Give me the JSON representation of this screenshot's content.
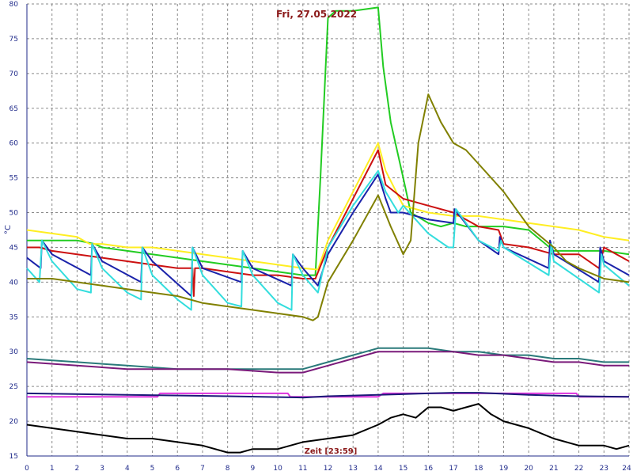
{
  "chart_data": {
    "type": "line",
    "title": "Fri, 27.05.2022",
    "xlabel": "",
    "ylabel": "°C",
    "annotation": "Zeit [23:59]",
    "xlim": [
      0,
      24
    ],
    "ylim": [
      15,
      80
    ],
    "xticks": [
      0,
      1,
      2,
      3,
      4,
      5,
      6,
      7,
      8,
      9,
      10,
      11,
      12,
      13,
      14,
      15,
      16,
      17,
      18,
      19,
      20,
      21,
      22,
      23,
      24
    ],
    "yticks": [
      15,
      20,
      25,
      30,
      35,
      40,
      45,
      50,
      55,
      60,
      65,
      70,
      75,
      80
    ],
    "grid": true,
    "series": [
      {
        "color": "#22cc22",
        "x": [
          0,
          1,
          2,
          2.7,
          3,
          4,
          5,
          6,
          7,
          8,
          9,
          10,
          11,
          11.5,
          11.7,
          12,
          12.3,
          13,
          14,
          14.2,
          14.5,
          15,
          15.3,
          16,
          16.5,
          17,
          17.5,
          18,
          19,
          20,
          21,
          21.5,
          22,
          23,
          24
        ],
        "y": [
          46,
          46,
          46,
          45.5,
          45,
          44.5,
          44,
          43.5,
          43,
          42.5,
          42,
          41.5,
          41,
          41,
          55,
          78,
          79,
          79,
          79.5,
          71,
          63,
          55,
          50,
          48.5,
          48,
          48.5,
          48,
          48,
          48,
          47.5,
          44.5,
          44.5,
          44.5,
          44.5,
          44
        ]
      },
      {
        "color": "#ffee22",
        "x": [
          0,
          1,
          2,
          2.5,
          3,
          4,
          5,
          6,
          7,
          8,
          9,
          10,
          11,
          11.6,
          12,
          13,
          14,
          14.3,
          15,
          16,
          17,
          18,
          19,
          20,
          21,
          22,
          23,
          24
        ],
        "y": [
          47.5,
          47,
          46.5,
          45.5,
          45.5,
          45,
          45,
          44.5,
          44,
          43.5,
          43,
          42.5,
          42,
          41.8,
          46,
          53,
          60,
          56,
          51,
          50,
          49.5,
          49.5,
          49,
          48.5,
          48,
          47.5,
          46.5,
          46
        ]
      },
      {
        "color": "#cc1111",
        "x": [
          0,
          0.5,
          1,
          2,
          3,
          4,
          5,
          6,
          6.6,
          6.65,
          6.7,
          7,
          8,
          9,
          10,
          11,
          11.5,
          12,
          13,
          14,
          14.3,
          15,
          16,
          17,
          18,
          18.8,
          19,
          20,
          21,
          21.5,
          22,
          22.8,
          23,
          24
        ],
        "y": [
          45,
          45,
          44.5,
          44,
          43.5,
          43,
          42.5,
          42,
          42,
          38,
          42,
          42,
          41.5,
          41,
          41,
          40.5,
          40.5,
          45,
          52,
          59,
          54,
          52,
          51,
          50,
          48,
          47.5,
          45.5,
          45,
          44,
          44,
          44,
          42,
          45,
          43
        ]
      },
      {
        "color": "#1a22aa",
        "x": [
          0,
          0.55,
          0.6,
          1,
          2.55,
          2.6,
          3,
          4.55,
          4.6,
          5,
          6.55,
          6.6,
          7,
          8.55,
          8.6,
          9,
          10.55,
          10.6,
          11,
          11.6,
          12,
          13,
          14,
          14.3,
          14.5,
          15,
          16,
          17,
          17.05,
          18,
          18.8,
          18.85,
          19,
          20.8,
          20.85,
          21,
          22.8,
          22.85,
          23,
          24
        ],
        "y": [
          43.5,
          42,
          46,
          44,
          41,
          45.5,
          43,
          40,
          45,
          43,
          38,
          45,
          42,
          40,
          44.5,
          42,
          39.5,
          44,
          42,
          39.5,
          44,
          50,
          55.5,
          52,
          50,
          50,
          49,
          48.5,
          50.5,
          46,
          44,
          46.5,
          45,
          42,
          46,
          44,
          40,
          45,
          43,
          41
        ]
      },
      {
        "color": "#33dddd",
        "x": [
          0,
          0.5,
          0.6,
          1,
          2,
          2.55,
          2.6,
          3,
          4,
          4.55,
          4.6,
          5,
          6,
          6.55,
          6.6,
          7,
          8,
          8.55,
          8.6,
          9,
          10,
          10.55,
          10.6,
          11,
          11.6,
          12,
          13,
          14,
          14.3,
          14.8,
          15,
          16,
          16.8,
          17,
          17.1,
          18,
          18.8,
          18.9,
          19,
          20.8,
          20.9,
          21,
          22.8,
          22.9,
          23,
          24
        ],
        "y": [
          42,
          40,
          46,
          43,
          39,
          38.5,
          45.5,
          42,
          38.5,
          37.5,
          45,
          41,
          37.5,
          36,
          45,
          41,
          37,
          36.5,
          44.5,
          41,
          37,
          36,
          44,
          41,
          38.5,
          45,
          51,
          56,
          53,
          50,
          51,
          47,
          45,
          45,
          50.5,
          46,
          44.5,
          46,
          45,
          41,
          45.5,
          43,
          38.5,
          44,
          42.5,
          39.5
        ]
      },
      {
        "color": "#808000",
        "x": [
          0,
          1,
          2,
          3,
          4,
          5,
          6,
          7,
          8,
          9,
          10,
          11,
          11.4,
          11.6,
          12,
          13,
          14,
          14.5,
          15,
          15.3,
          15.6,
          16,
          16.5,
          17,
          17.5,
          18,
          19,
          20,
          21,
          21.5,
          22,
          23,
          24
        ],
        "y": [
          40.5,
          40.5,
          40,
          39.5,
          39,
          38.5,
          38,
          37,
          36.5,
          36,
          35.5,
          35,
          34.5,
          35,
          40,
          46,
          52.5,
          48,
          44,
          46,
          60,
          67,
          63,
          60,
          59,
          57,
          53,
          48,
          45,
          43,
          42,
          40.5,
          40
        ]
      },
      {
        "color": "#2a7a7a",
        "x": [
          0,
          2,
          4,
          6,
          8,
          10,
          11,
          12,
          13,
          14,
          15,
          16,
          17,
          18,
          19,
          20,
          21,
          22,
          23,
          24
        ],
        "y": [
          29,
          28.5,
          28,
          27.5,
          27.5,
          27.5,
          27.5,
          28.5,
          29.5,
          30.5,
          30.5,
          30.5,
          30,
          30,
          29.5,
          29.5,
          29,
          29,
          28.5,
          28.5
        ]
      },
      {
        "color": "#7a1a7a",
        "x": [
          0,
          2,
          4,
          6,
          8,
          10,
          11,
          12,
          13,
          14,
          15,
          16,
          17,
          18,
          19,
          20,
          21,
          22,
          23,
          24
        ],
        "y": [
          28.5,
          28,
          27.5,
          27.5,
          27.5,
          27,
          27,
          28,
          29,
          30,
          30,
          30,
          30,
          29.5,
          29.5,
          29,
          28.5,
          28.5,
          28,
          28
        ]
      },
      {
        "color": "#dd33dd",
        "x": [
          0,
          5.2,
          5.3,
          5.4,
          5.5,
          10.4,
          10.5,
          11,
          14,
          14.2,
          21.9,
          22,
          24
        ],
        "y": [
          23.5,
          23.5,
          24,
          24,
          24,
          24,
          23.5,
          23.5,
          23.5,
          24,
          24,
          23.5,
          23.5
        ]
      },
      {
        "color": "#1a1a77",
        "x": [
          0,
          4,
          8,
          11,
          12,
          14,
          16,
          17,
          18,
          20,
          22,
          24
        ],
        "y": [
          24,
          23.8,
          23.6,
          23.4,
          23.6,
          23.8,
          24,
          24.1,
          24.1,
          23.8,
          23.6,
          23.5
        ]
      },
      {
        "color": "#000000",
        "x": [
          0,
          1,
          2,
          3,
          4,
          5,
          6,
          7,
          8,
          8.5,
          9,
          10,
          11,
          12,
          13,
          14,
          14.5,
          15,
          15.5,
          16,
          16.5,
          17,
          17.5,
          18,
          18.5,
          19,
          20,
          21,
          22,
          22.5,
          23,
          23.5,
          24
        ],
        "y": [
          19.5,
          19,
          18.5,
          18,
          17.5,
          17.5,
          17,
          16.5,
          15.5,
          15.5,
          16,
          16,
          17,
          17.5,
          18,
          19.5,
          20.5,
          21,
          20.5,
          22,
          22,
          21.5,
          22,
          22.5,
          21,
          20,
          19,
          17.5,
          16.5,
          16.5,
          16.5,
          16,
          16.5
        ]
      }
    ]
  }
}
